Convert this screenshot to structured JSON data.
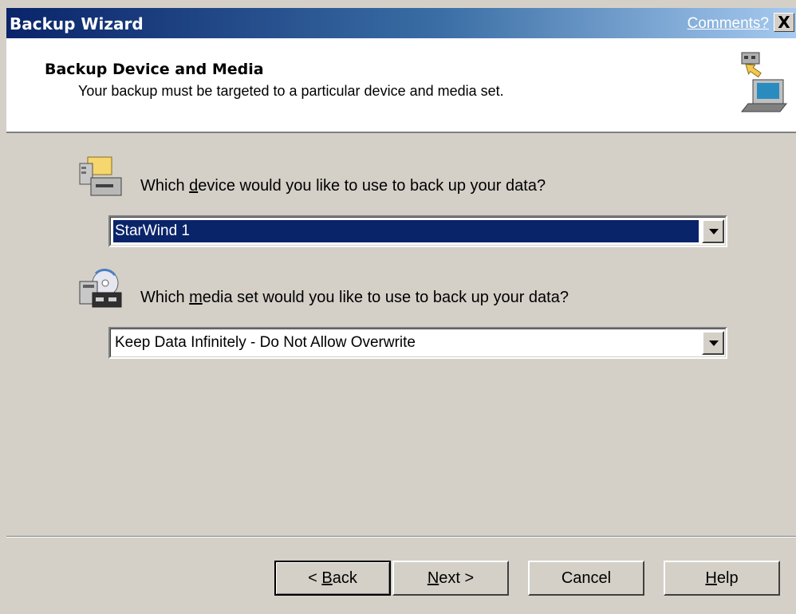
{
  "window": {
    "title": "Backup Wizard",
    "comments_link": "Comments?",
    "close_symbol": "X"
  },
  "header": {
    "title": "Backup Device and Media",
    "subtitle": "Your backup must be targeted to a particular device and media set.",
    "icon": "computer-backup-icon"
  },
  "device": {
    "icon": "backup-device-icon",
    "question_pre": "Which ",
    "question_accel": "d",
    "question_post": "evice would you like to use to back up your data?",
    "selected": "StarWind 1"
  },
  "media": {
    "icon": "media-set-icon",
    "question_pre": "Which ",
    "question_accel": "m",
    "question_post": "edia set would you like to use to back up your data?",
    "selected": "Keep Data Infinitely - Do Not Allow Overwrite"
  },
  "buttons": {
    "back": {
      "pre": "< ",
      "accel": "B",
      "post": "ack"
    },
    "next": {
      "pre": "",
      "accel": "N",
      "post": "ext >"
    },
    "cancel": {
      "pre": "Cancel",
      "accel": "",
      "post": ""
    },
    "help": {
      "pre": "",
      "accel": "H",
      "post": "elp"
    }
  },
  "colors": {
    "title_bar_start": "#0a246a",
    "title_bar_end": "#a6caf0",
    "dialog_face": "#d4d0c8",
    "selection": "#0a246a"
  }
}
